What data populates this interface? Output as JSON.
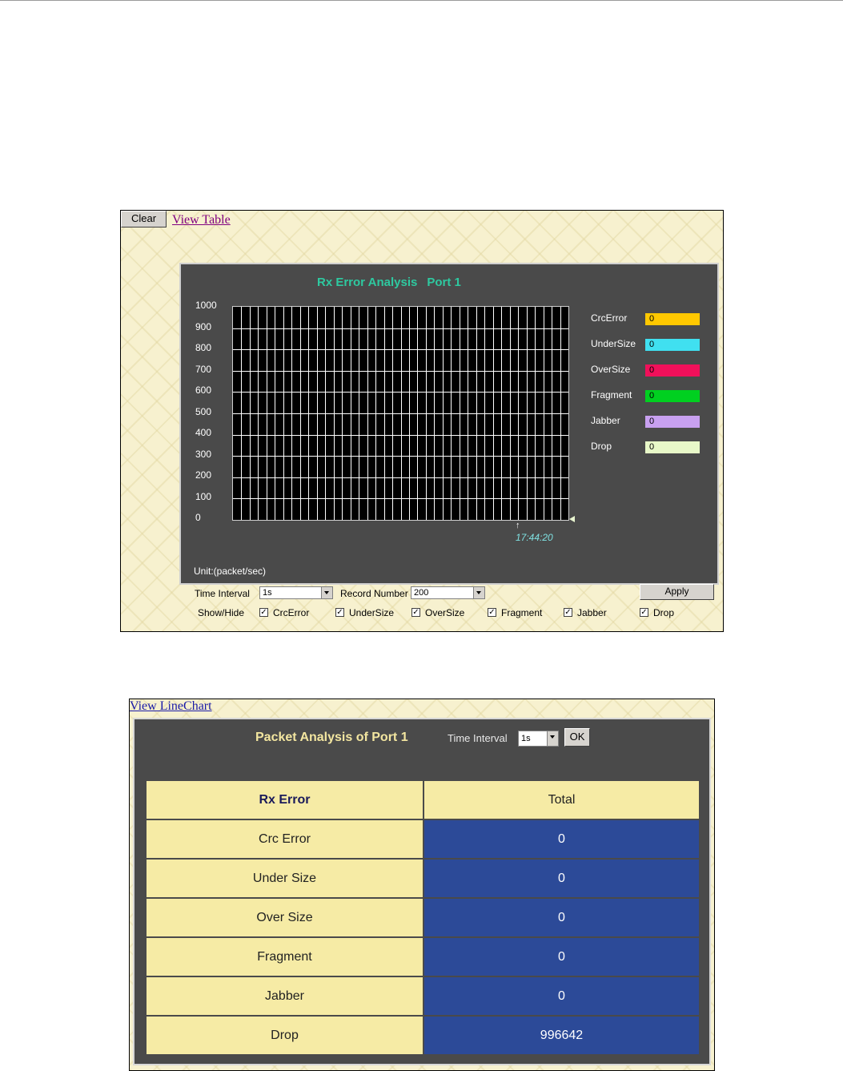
{
  "chart_panel": {
    "clear_label": "Clear",
    "view_table_label": "View Table",
    "title": "Rx Error Analysis",
    "port": "Port 1",
    "unit": "Unit:(packet/sec)",
    "time_marker": "↑",
    "time_label": "17:44:20",
    "legend": [
      {
        "label": "CrcError",
        "value": "0",
        "color": "#ffc800"
      },
      {
        "label": "UnderSize",
        "value": "0",
        "color": "#40e0f0"
      },
      {
        "label": "OverSize",
        "value": "0",
        "color": "#f0105a"
      },
      {
        "label": "Fragment",
        "value": "0",
        "color": "#00d020"
      },
      {
        "label": "Jabber",
        "value": "0",
        "color": "#c8a0f0"
      },
      {
        "label": "Drop",
        "value": "0",
        "color": "#e8f8c8"
      }
    ],
    "controls": {
      "time_interval_label": "Time Interval",
      "time_interval_value": "1s",
      "record_number_label": "Record Number",
      "record_number_value": "200",
      "apply_label": "Apply",
      "show_hide_label": "Show/Hide",
      "checkboxes": [
        {
          "label": "CrcError",
          "checked": true
        },
        {
          "label": "UnderSize",
          "checked": true
        },
        {
          "label": "OverSize",
          "checked": true
        },
        {
          "label": "Fragment",
          "checked": true
        },
        {
          "label": "Jabber",
          "checked": true
        },
        {
          "label": "Drop",
          "checked": true
        }
      ]
    }
  },
  "chart_data": {
    "type": "line",
    "title": "Rx Error Analysis   Port 1",
    "ylabel": "Unit:(packet/sec)",
    "ylim": [
      0,
      1000
    ],
    "yticks": [
      "1000",
      "900",
      "800",
      "700",
      "600",
      "500",
      "400",
      "300",
      "200",
      "100",
      "0"
    ],
    "x": [
      "17:44:20"
    ],
    "grid": true,
    "legend_position": "right",
    "series": [
      {
        "name": "CrcError",
        "values": [
          0
        ]
      },
      {
        "name": "UnderSize",
        "values": [
          0
        ]
      },
      {
        "name": "OverSize",
        "values": [
          0
        ]
      },
      {
        "name": "Fragment",
        "values": [
          0
        ]
      },
      {
        "name": "Jabber",
        "values": [
          0
        ]
      },
      {
        "name": "Drop",
        "values": [
          0
        ]
      }
    ]
  },
  "table_panel": {
    "view_linechart_label": "View LineChart",
    "title": "Packet Analysis of Port 1",
    "time_interval_label": "Time Interval",
    "time_interval_value": "1s",
    "ok_label": "OK",
    "header": {
      "left": "Rx Error",
      "right": "Total"
    },
    "rows": [
      {
        "label": "Crc Error",
        "value": "0"
      },
      {
        "label": "Under Size",
        "value": "0"
      },
      {
        "label": "Over Size",
        "value": "0"
      },
      {
        "label": "Fragment",
        "value": "0"
      },
      {
        "label": "Jabber",
        "value": "0"
      },
      {
        "label": "Drop",
        "value": "996642"
      }
    ]
  }
}
